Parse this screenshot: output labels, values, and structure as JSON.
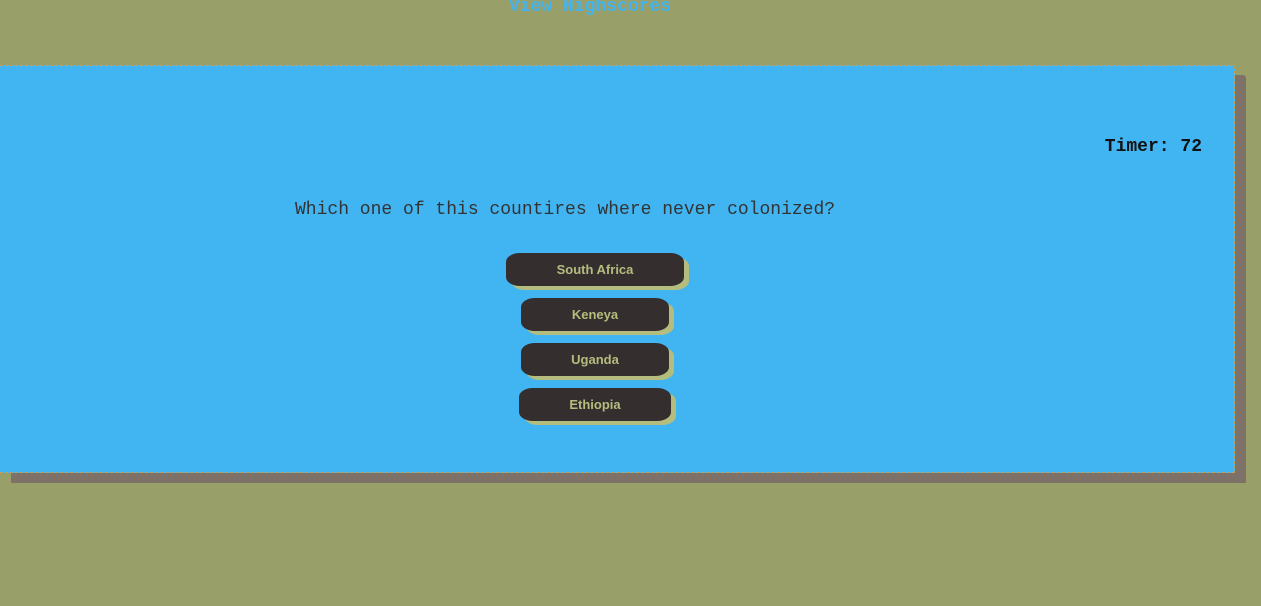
{
  "header": {
    "highscores_link": "View Highscores"
  },
  "quiz": {
    "timer_label": "Timer:",
    "timer_value": "72",
    "timer_text": "Timer: 72",
    "question": "Which one of this countires where never colonized?",
    "answers": [
      {
        "label": "South Africa"
      },
      {
        "label": "Keneya"
      },
      {
        "label": "Uganda"
      },
      {
        "label": "Ethiopia"
      }
    ]
  },
  "colors": {
    "page_background": "#989f68",
    "card_background": "#41b5f2",
    "card_shadow": "#7d7168",
    "button_background": "#342e2f",
    "button_text": "#b5bd7e",
    "link": "#43b4f0"
  }
}
